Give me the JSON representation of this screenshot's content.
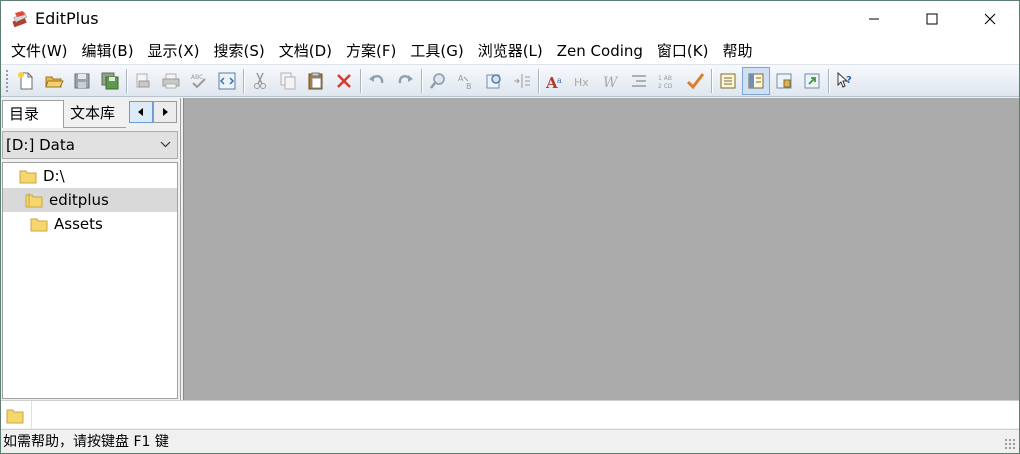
{
  "window": {
    "title": "EditPlus"
  },
  "menu": {
    "items": [
      "文件(W)",
      "编辑(B)",
      "显示(X)",
      "搜索(S)",
      "文档(D)",
      "方案(F)",
      "工具(G)",
      "浏览器(L)",
      "Zen Coding",
      "窗口(K)",
      "帮助"
    ]
  },
  "toolbar": {
    "buttons": [
      "new-file-icon",
      "open-folder-icon",
      "save-icon",
      "save-all-icon",
      "print-preview-icon",
      "print-icon",
      "spell-check-icon",
      "browser-preview-icon",
      "cut-icon",
      "copy-icon",
      "paste-icon",
      "delete-icon",
      "undo-icon",
      "redo-icon",
      "find-icon",
      "replace-icon",
      "find-in-files-icon",
      "go-to-line-icon",
      "font-icon",
      "hex-view-icon",
      "word-wrap-icon",
      "indent-icon",
      "line-number-icon",
      "check-icon",
      "view-document-icon",
      "view-directory-icon",
      "view-cliptext-icon",
      "view-output-icon",
      "help-cursor-icon"
    ]
  },
  "left_panel": {
    "tabs": [
      "目录",
      "文本库"
    ],
    "active_tab": "目录",
    "drive": "[D:] Data",
    "tree": [
      {
        "label": "D:\\",
        "level": 0,
        "selected": false
      },
      {
        "label": "editplus",
        "level": 1,
        "selected": true
      },
      {
        "label": "Assets",
        "level": 1,
        "selected": false
      }
    ]
  },
  "status": {
    "text": "如需帮助，请按键盘 F1 键"
  },
  "colors": {
    "folder": "#f5d76e",
    "editor_bg": "#ababab",
    "selection": "#d9d9d9"
  }
}
